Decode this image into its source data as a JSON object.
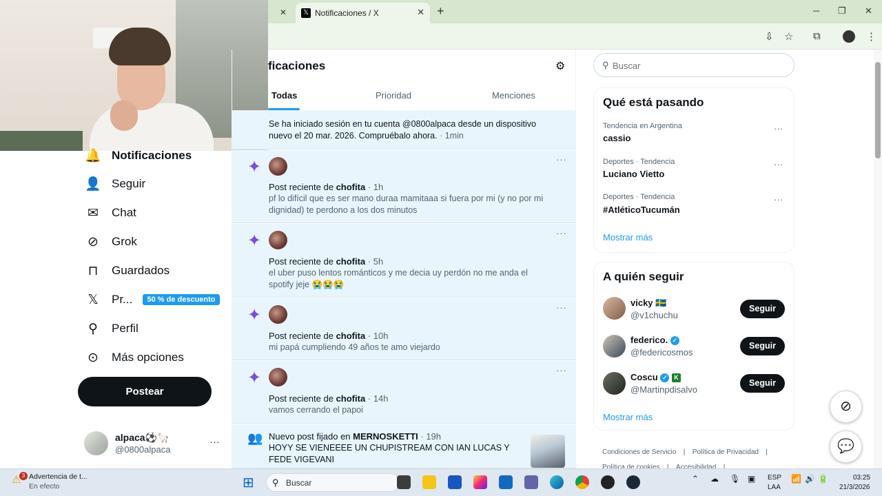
{
  "browser": {
    "prev_tab_close": "✕",
    "active_tab_title": "Notificaciones / X",
    "active_tab_close": "✕",
    "new_tab": "+",
    "win_min": "─",
    "win_max": "❐",
    "win_close": "✕"
  },
  "nav": {
    "items": [
      {
        "label": "Notificaciones",
        "icon": "bell-icon"
      },
      {
        "label": "Seguir",
        "icon": "person-plus-icon"
      },
      {
        "label": "Chat",
        "icon": "envelope-icon"
      },
      {
        "label": "Grok",
        "icon": "grok-icon"
      },
      {
        "label": "Guardados",
        "icon": "bookmark-icon"
      },
      {
        "label": "Pr...",
        "icon": "x-logo-icon"
      },
      {
        "label": "Perfil",
        "icon": "person-icon"
      },
      {
        "label": "Más opciones",
        "icon": "more-circle-icon"
      }
    ],
    "premium_badge": "50 % de descuento",
    "post_button": "Postear",
    "account": {
      "name": "alpaca⚽🦙",
      "handle": "@0800alpaca",
      "more": "···"
    }
  },
  "notifications": {
    "title": "ficaciones",
    "tabs": [
      "Todas",
      "Prioridad",
      "Menciones"
    ],
    "login": {
      "text": "Se ha iniciado sesión en tu cuenta @0800alpaca desde un dispositivo nuevo el 20 mar. 2026. Compruébalo ahora.",
      "time": " · 1min"
    },
    "items": [
      {
        "prefix": "Post reciente de ",
        "user": "chofita",
        "time": " · 1h",
        "body": "pf lo difícil que es ser mano duraa mamitaaa si fuera por mi (y no por mi dignidad) te perdono a los dos minutos"
      },
      {
        "prefix": "Post reciente de ",
        "user": "chofita",
        "time": " · 5h",
        "body": "el uber puso lentos románticos y me decia uy perdón no me anda el spotify jeje 😭😭😭"
      },
      {
        "prefix": "Post reciente de ",
        "user": "chofita",
        "time": " · 10h",
        "body": "mi papá cumpliendo 49 años te amo viejardo"
      },
      {
        "prefix": "Post reciente de ",
        "user": "chofita",
        "time": " · 14h",
        "body": "vamos cerrando el papoi"
      }
    ],
    "pinned": {
      "prefix": "Nuevo post fijado en ",
      "user": "MERNOSKETTI",
      "time": " · 19h",
      "body": "HOYY SE VIENEEEE UN CHUPISTREAM CON IAN LUCAS Y FEDE VIGEVANI"
    }
  },
  "search": {
    "placeholder": "Buscar"
  },
  "trends": {
    "title": "Qué está pasando",
    "items": [
      {
        "category": "Tendencia en Argentina",
        "name": "cassio"
      },
      {
        "category": "Deportes · Tendencia",
        "name": "Luciano Vietto"
      },
      {
        "category": "Deportes · Tendencia",
        "name": "#AtléticoTucumán"
      }
    ],
    "more": "Mostrar más"
  },
  "who_to_follow": {
    "title": "A quién seguir",
    "items": [
      {
        "name": "vicky 🇸🇪",
        "handle": "@v1chuchu",
        "button": "Seguir"
      },
      {
        "name": "federico.",
        "handle": "@federicosmos",
        "button": "Seguir"
      },
      {
        "name": "Coscu",
        "handle": "@Martinpdisalvo",
        "button": "Seguir"
      }
    ],
    "more": "Mostrar más"
  },
  "footer": {
    "links": [
      "Condiciones de Servicio",
      "Política de Privacidad",
      "Política de cookies",
      "Accesibilidad"
    ],
    "sep": "|"
  },
  "taskbar": {
    "notification_count": "3",
    "notification_title": "Advertencia de t...",
    "notification_sub": "En efecto",
    "search": "Buscar",
    "lang": "ESP",
    "lang2": "LAA",
    "time": "03:25",
    "date": "21/3/2026"
  }
}
